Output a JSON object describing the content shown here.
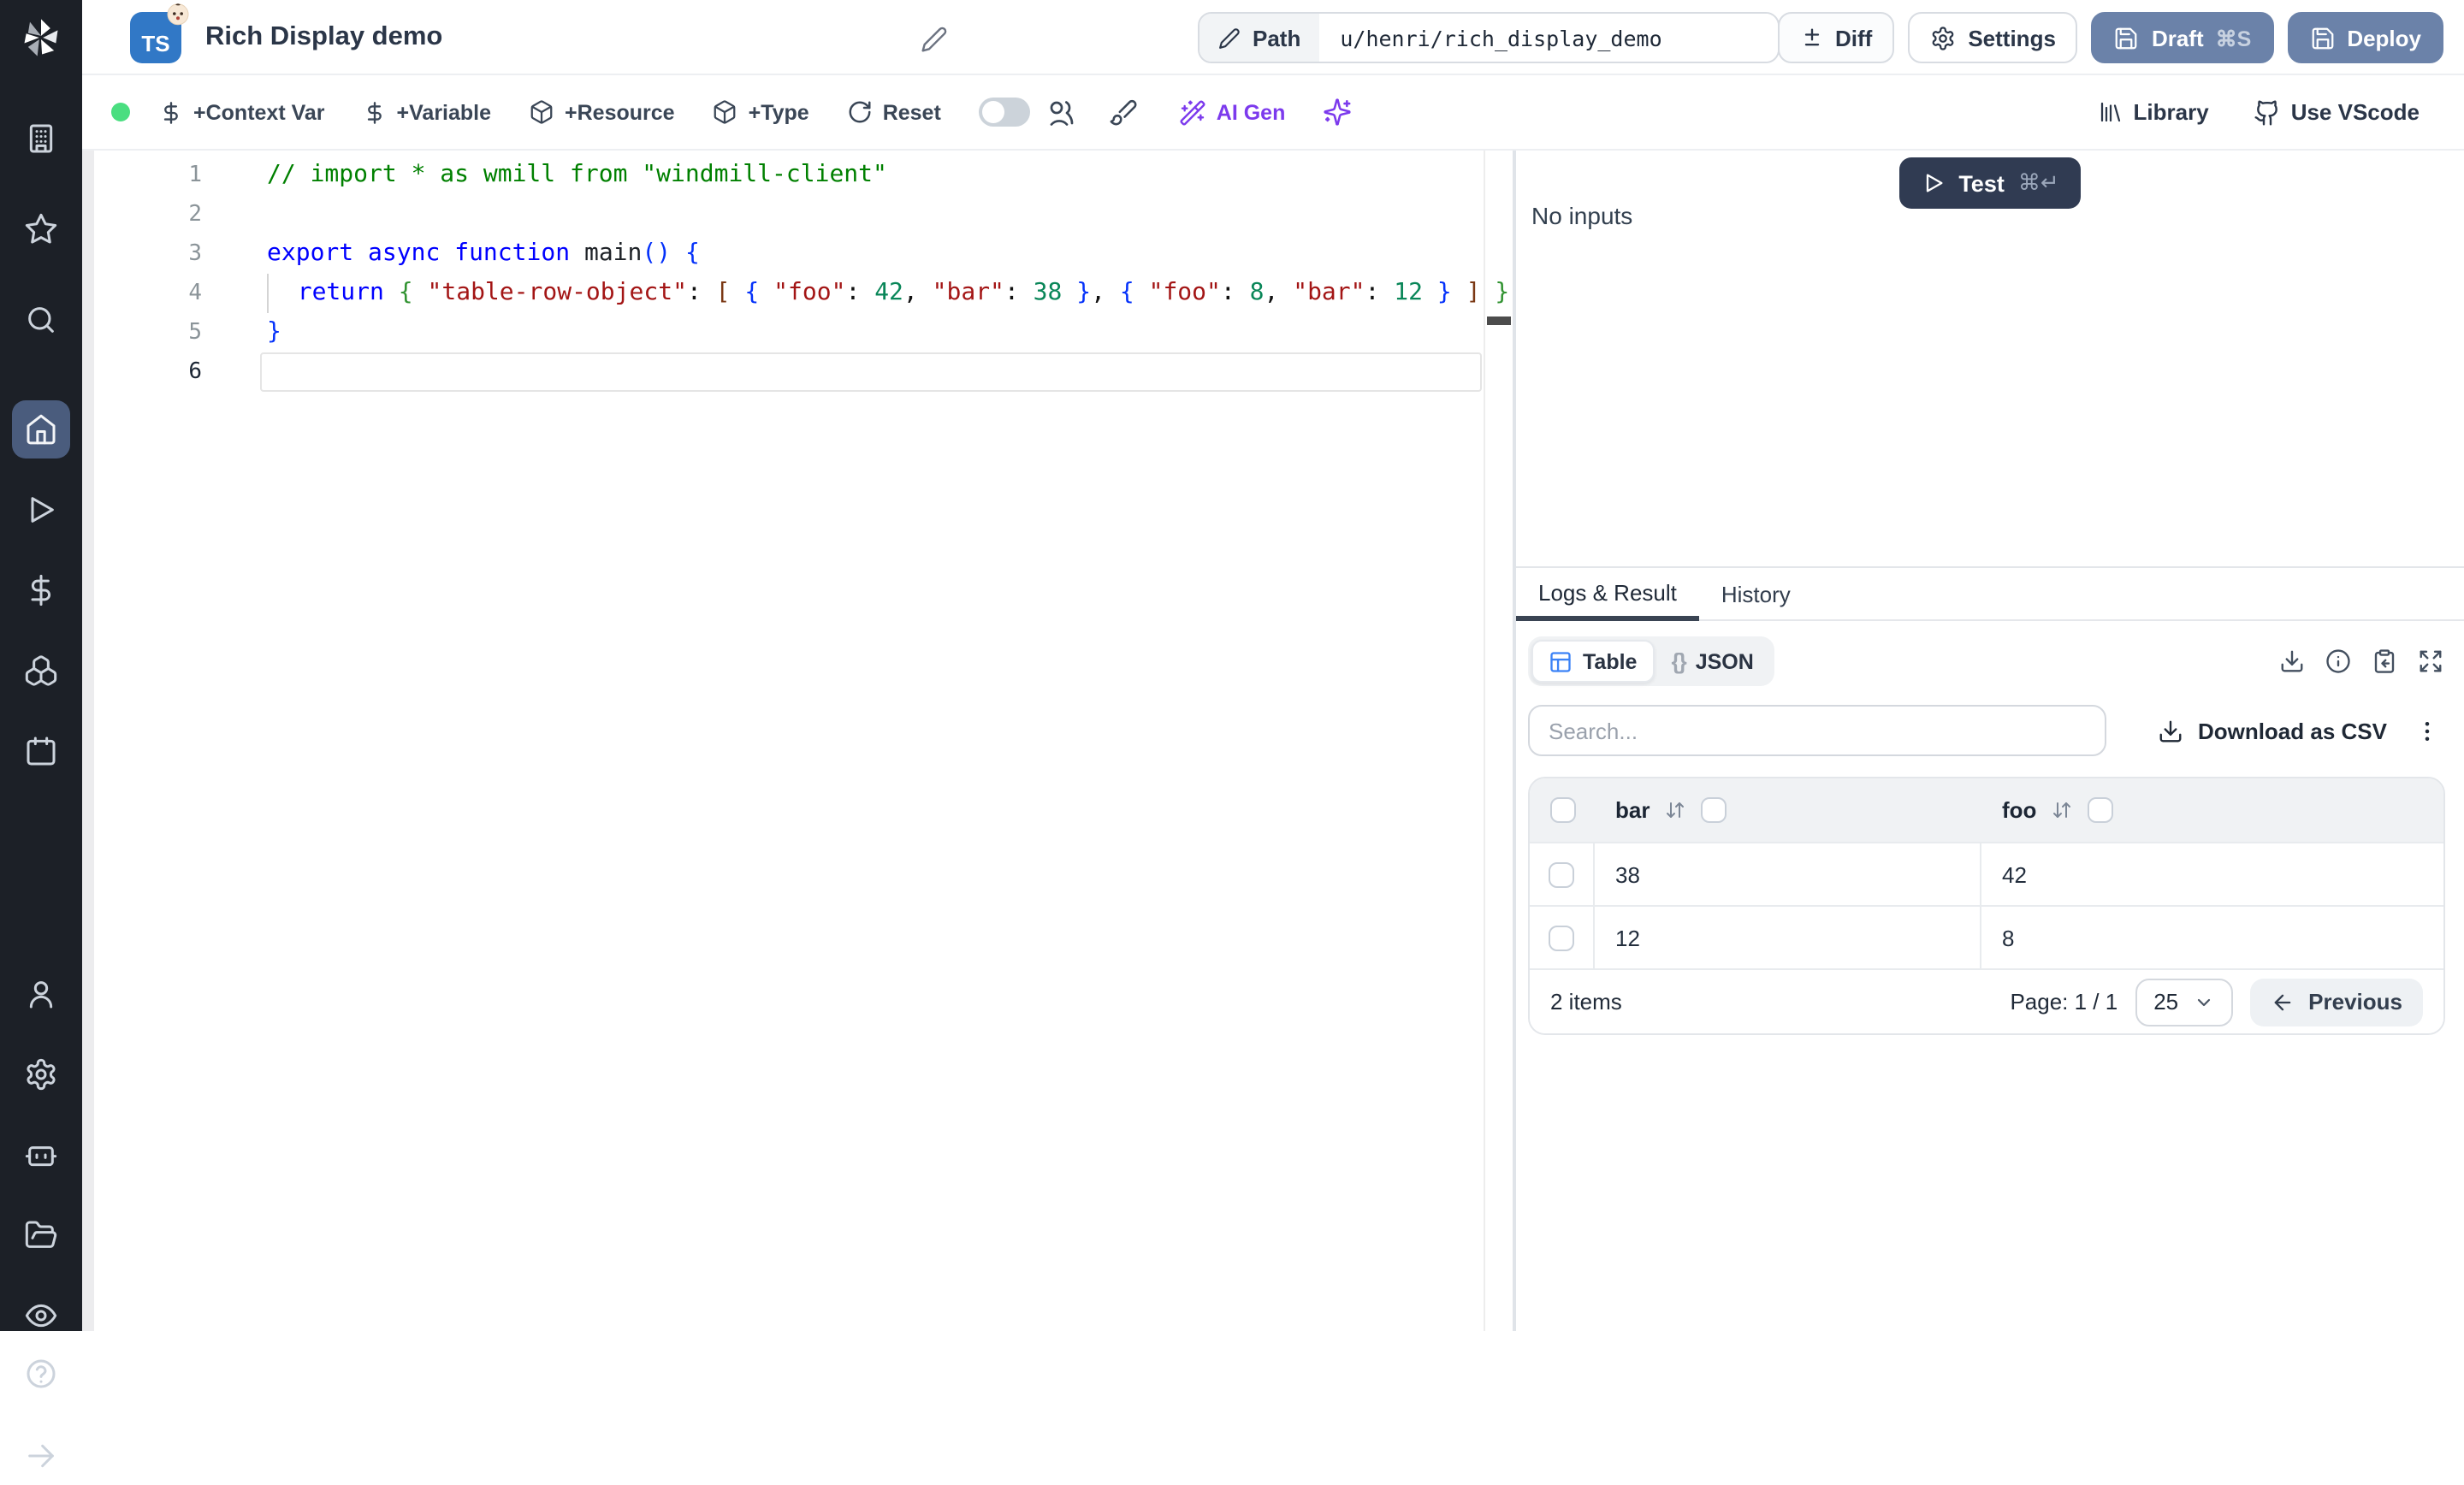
{
  "colors": {
    "accent-purple": "#7c3aed",
    "action-blue": "#6b82a9",
    "test-navy": "#303b52",
    "ts-blue": "#3178c6",
    "status-green": "#4ade80",
    "table-icon-blue": "#3b82f6",
    "sidebar-bg": "#1c2027",
    "sidebar-active": "#4a5c7d"
  },
  "sidebar": {
    "icons": [
      "windmill-logo",
      "building",
      "star",
      "search",
      "home",
      "play",
      "dollar-sign",
      "boxes",
      "calendar",
      "user",
      "settings",
      "bot",
      "folder-open",
      "eye",
      "help-circle",
      "arrow-right"
    ],
    "active_item": "home"
  },
  "header": {
    "ts_badge": "TS",
    "title": "Rich Display demo",
    "path_label": "Path",
    "path_value": "u/henri/rich_display_demo",
    "diff_label": "Diff",
    "settings_label": "Settings",
    "draft_label": "Draft",
    "draft_shortcut": "⌘S",
    "deploy_label": "Deploy"
  },
  "toolbar": {
    "context_var_label": "+Context Var",
    "variable_label": "+Variable",
    "resource_label": "+Resource",
    "type_label": "+Type",
    "reset_label": "Reset",
    "ai_gen_label": "AI Gen",
    "library_label": "Library",
    "vscode_label": "Use VScode"
  },
  "editor": {
    "lines": [
      {
        "num": 1,
        "tokens": [
          {
            "t": "// import * as wmill from \"windmill-client\"",
            "c": "comment"
          }
        ]
      },
      {
        "num": 2,
        "tokens": []
      },
      {
        "num": 3,
        "tokens": [
          {
            "t": "export",
            "c": "kw"
          },
          {
            "t": " ",
            "c": "pl"
          },
          {
            "t": "async",
            "c": "kw"
          },
          {
            "t": " ",
            "c": "pl"
          },
          {
            "t": "function",
            "c": "kw"
          },
          {
            "t": " ",
            "c": "pl"
          },
          {
            "t": "main",
            "c": "fn"
          },
          {
            "t": "()",
            "c": "br1"
          },
          {
            "t": " ",
            "c": "pl"
          },
          {
            "t": "{",
            "c": "br1"
          }
        ]
      },
      {
        "num": 4,
        "tokens": [
          {
            "t": "",
            "c": "guide"
          },
          {
            "t": "  ",
            "c": "pl"
          },
          {
            "t": "return",
            "c": "kw"
          },
          {
            "t": " ",
            "c": "pl"
          },
          {
            "t": "{",
            "c": "br2"
          },
          {
            "t": " ",
            "c": "pl"
          },
          {
            "t": "\"table-row-object\"",
            "c": "str"
          },
          {
            "t": ": ",
            "c": "pl"
          },
          {
            "t": "[",
            "c": "br3"
          },
          {
            "t": " ",
            "c": "pl"
          },
          {
            "t": "{",
            "c": "br1"
          },
          {
            "t": " ",
            "c": "pl"
          },
          {
            "t": "\"foo\"",
            "c": "str"
          },
          {
            "t": ": ",
            "c": "pl"
          },
          {
            "t": "42",
            "c": "num"
          },
          {
            "t": ", ",
            "c": "pl"
          },
          {
            "t": "\"bar\"",
            "c": "str"
          },
          {
            "t": ": ",
            "c": "pl"
          },
          {
            "t": "38",
            "c": "num"
          },
          {
            "t": " ",
            "c": "pl"
          },
          {
            "t": "}",
            "c": "br1"
          },
          {
            "t": ", ",
            "c": "pl"
          },
          {
            "t": "{",
            "c": "br1"
          },
          {
            "t": " ",
            "c": "pl"
          },
          {
            "t": "\"foo\"",
            "c": "str"
          },
          {
            "t": ": ",
            "c": "pl"
          },
          {
            "t": "8",
            "c": "num"
          },
          {
            "t": ", ",
            "c": "pl"
          },
          {
            "t": "\"bar\"",
            "c": "str"
          },
          {
            "t": ": ",
            "c": "pl"
          },
          {
            "t": "12",
            "c": "num"
          },
          {
            "t": " ",
            "c": "pl"
          },
          {
            "t": "}",
            "c": "br1"
          },
          {
            "t": " ",
            "c": "pl"
          },
          {
            "t": "]",
            "c": "br3"
          },
          {
            "t": " ",
            "c": "pl"
          },
          {
            "t": "}",
            "c": "br2"
          }
        ]
      },
      {
        "num": 5,
        "tokens": [
          {
            "t": "}",
            "c": "br1"
          }
        ]
      },
      {
        "num": 6,
        "tokens": [],
        "current": true
      }
    ]
  },
  "run": {
    "test_label": "Test",
    "test_shortcut": "⌘↵",
    "no_inputs": "No inputs"
  },
  "result": {
    "tabs": [
      {
        "label": "Logs & Result",
        "active": true
      },
      {
        "label": "History",
        "active": false
      }
    ],
    "view_modes": [
      {
        "label": "Table",
        "active": true
      },
      {
        "label": "JSON",
        "active": false
      }
    ],
    "json_glyph": "{}",
    "search_placeholder": "Search...",
    "download_csv_label": "Download as CSV",
    "table": {
      "columns": [
        "bar",
        "foo"
      ],
      "rows": [
        [
          "38",
          "42"
        ],
        [
          "12",
          "8"
        ]
      ]
    },
    "footer": {
      "items_label": "2 items",
      "page_label": "Page: 1 / 1",
      "page_size": "25",
      "previous_label": "Previous"
    }
  }
}
